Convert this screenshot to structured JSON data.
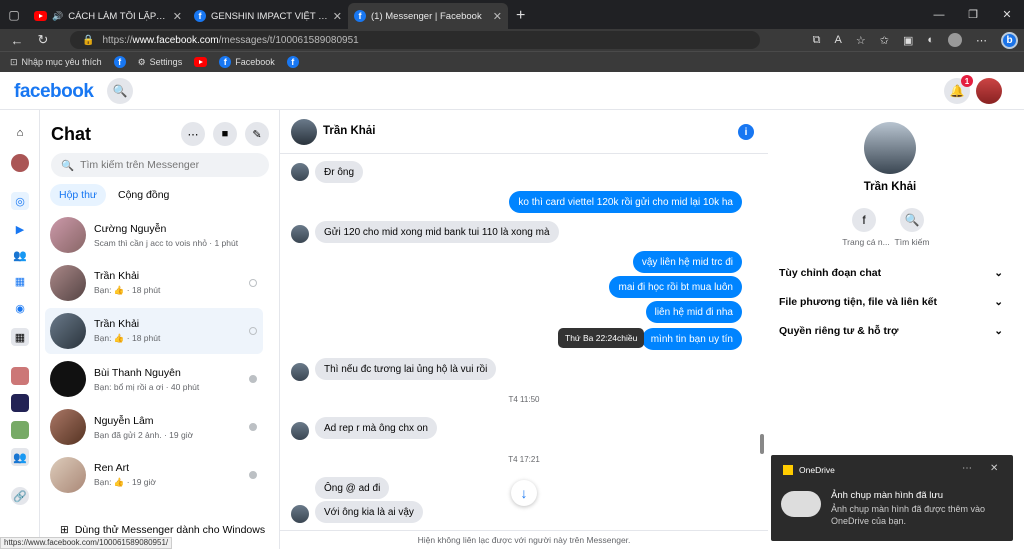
{
  "browser": {
    "tabs": [
      {
        "label": "CÁCH LÀM TÔI LẬP BẤT - N",
        "icon": "youtube-icon",
        "active": false
      },
      {
        "label": "GENSHIN IMPACT VIỆT NAM TRA",
        "icon": "facebook-icon",
        "active": false
      },
      {
        "label": "(1) Messenger | Facebook",
        "icon": "facebook-icon",
        "active": true
      }
    ],
    "url_prefix": "https://",
    "url_domain": "www.facebook.com",
    "url_path": "/messages/t/100061589080951",
    "bookmarks": [
      "Nhập mục yêu thích",
      "Settings",
      "Facebook"
    ]
  },
  "facebook": {
    "logo": "facebook",
    "notification_count": "1"
  },
  "chat_list": {
    "title": "Chat",
    "search_placeholder": "Tìm kiếm trên Messenger",
    "tabs": [
      "Hộp thư",
      "Cộng đồng"
    ],
    "conversations": [
      {
        "name": "Cường Nguyễn",
        "preview": "Scam thì cần j acc to vois nhỏ · 1 phút"
      },
      {
        "name": "Trần Khải",
        "preview": "Bạn: 👍 · 18 phút"
      },
      {
        "name": "Trần Khải",
        "preview": "Bạn: 👍 · 18 phút"
      },
      {
        "name": "Bùi Thanh Nguyên",
        "preview": "Bạn: bổ mị rồi a ơi · 40 phút"
      },
      {
        "name": "Nguyễn Lâm",
        "preview": "Bạn đã gửi 2 ảnh. · 19 giờ"
      },
      {
        "name": "Ren Art",
        "preview": "Bạn: 👍 · 19 giờ"
      }
    ],
    "try_windows": "Dùng thử Messenger dành cho Windows"
  },
  "conversation": {
    "contact": "Trần Khải",
    "messages": [
      {
        "dir": "in",
        "text": "Đr ông"
      },
      {
        "dir": "out",
        "text": "ko thì card viettel 120k rồi gửi cho mid lại 10k ha"
      },
      {
        "dir": "in",
        "text": "Gửi 120 cho mid xong mid bank tui 110 là xong mà"
      },
      {
        "dir": "out",
        "text": "vậy liên hệ mid trc đi"
      },
      {
        "dir": "out",
        "text": "mai đi học rồi bt mua luôn"
      },
      {
        "dir": "out",
        "text": "liên hệ mid đi nha"
      },
      {
        "dir": "out",
        "text": "mình tin bạn uy tín"
      },
      {
        "dir": "in",
        "text": "Thì nếu đc tương lai ủng hộ là vui rồi"
      },
      {
        "dir": "in",
        "text": "Ad rep r mà ông chx on"
      },
      {
        "dir": "in",
        "text": "Ông @ ad đi"
      },
      {
        "dir": "in",
        "text": "Với ông kia là ai vậy"
      }
    ],
    "timestamps": [
      "T4 11:50",
      "T4 17:21"
    ],
    "tooltip": "Thứ Ba 22:24chiều",
    "footer": "Hiện không liên lạc được với người này trên Messenger."
  },
  "info_panel": {
    "name": "Trần Khải",
    "profile_label": "Trang cá n...",
    "search_label": "Tìm kiếm",
    "sections": [
      "Tùy chỉnh đoạn chat",
      "File phương tiện, file và liên kết",
      "Quyền riêng tư & hỗ trợ"
    ]
  },
  "onedrive": {
    "app": "OneDrive",
    "title": "Ảnh chụp màn hình đã lưu",
    "body": "Ảnh chụp màn hình đã được thêm vào OneDrive của bạn."
  },
  "status_url": "https://www.facebook.com/100061589080951/"
}
